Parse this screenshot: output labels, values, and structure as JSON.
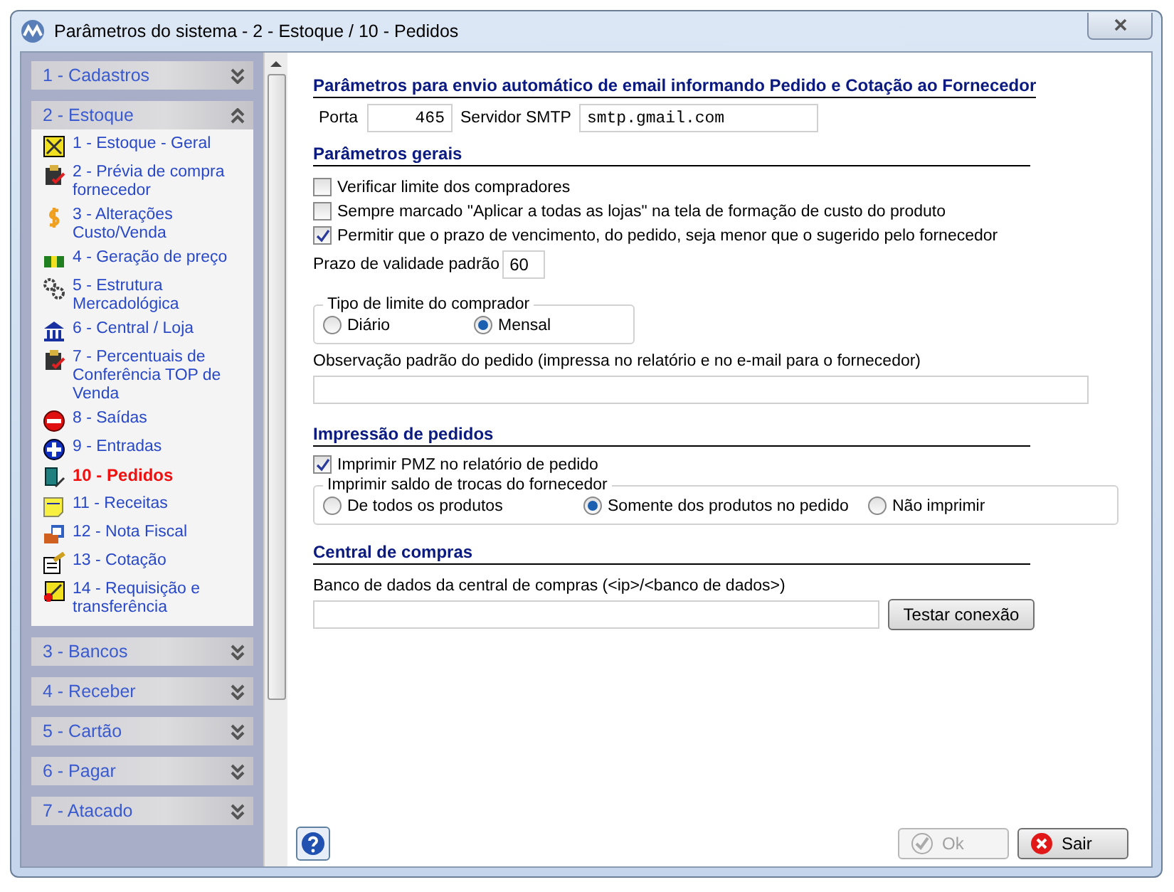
{
  "window": {
    "title": "Parâmetros do sistema - 2 - Estoque / 10 - Pedidos"
  },
  "sidebar": {
    "groups": [
      {
        "label": "1 - Cadastros",
        "expanded": false
      },
      {
        "label": "2 - Estoque",
        "expanded": true,
        "items": [
          {
            "label": "1 - Estoque - Geral",
            "selected": false
          },
          {
            "label": "2 - Prévia de compra fornecedor",
            "selected": false
          },
          {
            "label": "3 - Alterações Custo/Venda",
            "selected": false
          },
          {
            "label": "4 - Geração de preço",
            "selected": false
          },
          {
            "label": "5 - Estrutura Mercadológica",
            "selected": false
          },
          {
            "label": "6 - Central / Loja",
            "selected": false
          },
          {
            "label": "7 - Percentuais de Conferência TOP de Venda",
            "selected": false
          },
          {
            "label": "8 - Saídas",
            "selected": false
          },
          {
            "label": "9 - Entradas",
            "selected": false
          },
          {
            "label": "10 - Pedidos",
            "selected": true
          },
          {
            "label": "11 - Receitas",
            "selected": false
          },
          {
            "label": "12 - Nota Fiscal",
            "selected": false
          },
          {
            "label": "13 - Cotação",
            "selected": false
          },
          {
            "label": "14 - Requisição e transferência",
            "selected": false
          }
        ]
      },
      {
        "label": "3 - Bancos",
        "expanded": false
      },
      {
        "label": "4 - Receber",
        "expanded": false
      },
      {
        "label": "5 - Cartão",
        "expanded": false
      },
      {
        "label": "6 - Pagar",
        "expanded": false
      },
      {
        "label": "7 - Atacado",
        "expanded": false
      }
    ]
  },
  "email": {
    "heading": "Parâmetros para envio automático de email informando Pedido e Cotação ao Fornecedor",
    "port_label": "Porta",
    "port": "465",
    "smtp_label": "Servidor SMTP",
    "smtp": "smtp.gmail.com"
  },
  "general": {
    "heading": "Parâmetros gerais",
    "checkboxes": [
      {
        "label": "Verificar limite dos compradores",
        "checked": false
      },
      {
        "label": "Sempre marcado \"Aplicar a todas as lojas\" na tela de formação de custo do produto",
        "checked": false
      },
      {
        "label": "Permitir que o prazo de vencimento, do pedido, seja menor que o sugerido pelo fornecedor",
        "checked": true
      }
    ],
    "validity_label": "Prazo de validade padrão",
    "validity": "60",
    "limit_group": {
      "title": "Tipo de limite do comprador",
      "options": [
        {
          "label": "Diário",
          "selected": false
        },
        {
          "label": "Mensal",
          "selected": true
        }
      ]
    },
    "note_label": "Observação padrão do pedido (impressa no relatório e no e-mail para o fornecedor)"
  },
  "printing": {
    "heading": "Impressão de pedidos",
    "checkboxes": [
      {
        "label": "Imprimir PMZ no relatório  de pedido",
        "checked": true
      }
    ],
    "exchange_group": {
      "title": "Imprimir saldo de trocas do fornecedor",
      "options": [
        {
          "label": "De todos os produtos",
          "selected": false
        },
        {
          "label": "Somente dos produtos no pedido",
          "selected": true
        },
        {
          "label": "Não imprimir",
          "selected": false
        }
      ]
    }
  },
  "central": {
    "heading": "Central de compras",
    "db_label": "Banco de dados da central de compras (<ip>/<banco de dados>)",
    "test_button": "Testar conexão"
  },
  "footer": {
    "ok": {
      "label": "Ok",
      "disabled": true
    },
    "exit": "Sair"
  }
}
